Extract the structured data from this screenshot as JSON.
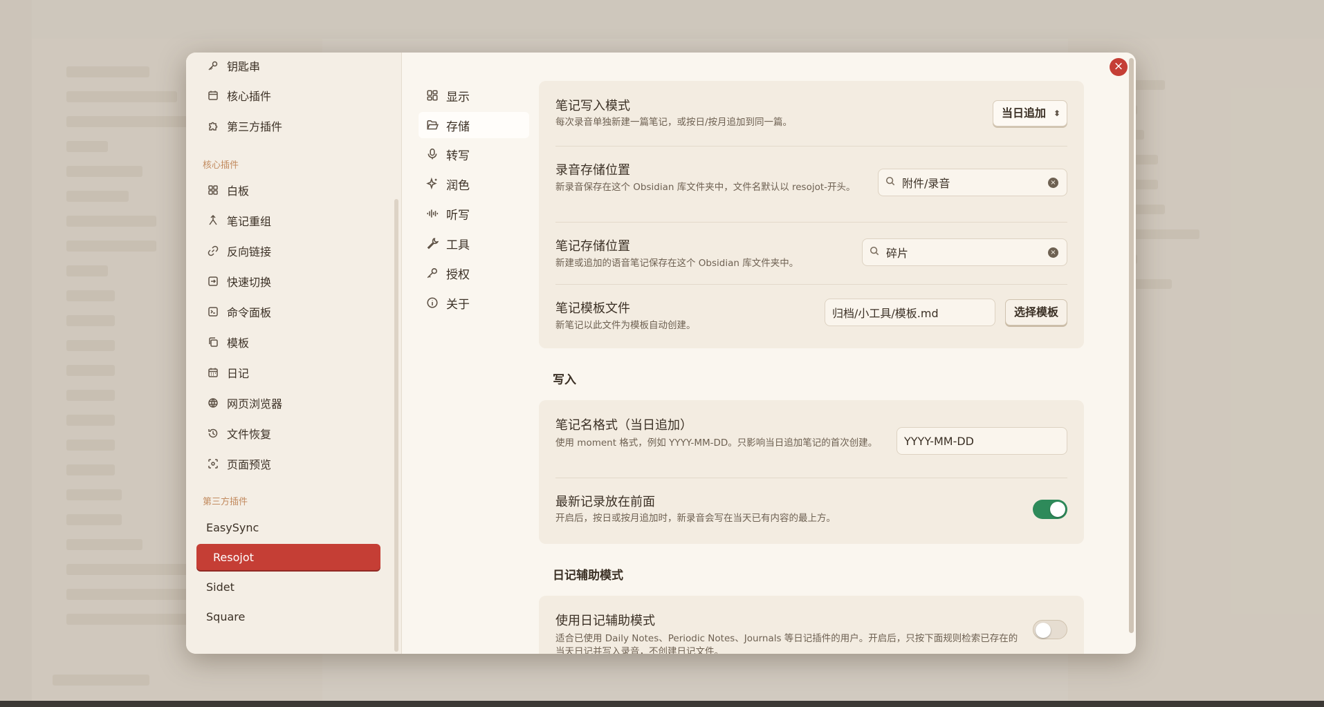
{
  "settings_sidebar": {
    "top_items": [
      {
        "label": "钥匙串",
        "icon": "key-icon"
      },
      {
        "label": "核心插件",
        "icon": "calendar-icon"
      },
      {
        "label": "第三方插件",
        "icon": "puzzle-icon"
      }
    ],
    "core_section_label": "核心插件",
    "core_items": [
      {
        "label": "白板",
        "icon": "canvas-icon"
      },
      {
        "label": "笔记重组",
        "icon": "merge-icon"
      },
      {
        "label": "反向链接",
        "icon": "link-icon"
      },
      {
        "label": "快速切换",
        "icon": "switch-icon"
      },
      {
        "label": "命令面板",
        "icon": "terminal-icon"
      },
      {
        "label": "模板",
        "icon": "copy-icon"
      },
      {
        "label": "日记",
        "icon": "calendar-icon"
      },
      {
        "label": "网页浏览器",
        "icon": "globe-icon"
      },
      {
        "label": "文件恢复",
        "icon": "history-icon"
      },
      {
        "label": "页面预览",
        "icon": "scan-eye-icon"
      }
    ],
    "third_party_section_label": "第三方插件",
    "third_party_items": [
      {
        "label": "EasySync"
      },
      {
        "label": "Resojot"
      },
      {
        "label": "Sidet"
      },
      {
        "label": "Square"
      }
    ],
    "active_item": "Resojot"
  },
  "tabs": [
    {
      "label": "显示",
      "icon": "layout-icon"
    },
    {
      "label": "存储",
      "icon": "folder-open-icon"
    },
    {
      "label": "转写",
      "icon": "microphone-icon"
    },
    {
      "label": "润色",
      "icon": "sparkles-icon"
    },
    {
      "label": "听写",
      "icon": "audio-lines-icon"
    },
    {
      "label": "工具",
      "icon": "wrench-icon"
    },
    {
      "label": "授权",
      "icon": "key-round-icon"
    },
    {
      "label": "关于",
      "icon": "info-icon"
    }
  ],
  "active_tab": "存储",
  "storage": {
    "write_mode": {
      "title": "笔记写入模式",
      "desc": "每次录音单独新建一篇笔记，或按日/按月追加到同一篇。",
      "value": "当日追加"
    },
    "audio_location": {
      "title": "录音存储位置",
      "desc": "新录音保存在这个 Obsidian 库文件夹中，文件名默认以 resojot-开头。",
      "value": "附件/录音"
    },
    "note_location": {
      "title": "笔记存储位置",
      "desc": "新建或追加的语音笔记保存在这个 Obsidian 库文件夹中。",
      "value": "碎片"
    },
    "template_file": {
      "title": "笔记模板文件",
      "desc": "新笔记以此文件为模板自动创建。",
      "value": "归档/小工具/模板.md",
      "button": "选择模板"
    }
  },
  "write_section": {
    "heading": "写入",
    "name_format": {
      "title": "笔记名格式（当日追加）",
      "desc": "使用 moment 格式，例如 YYYY-MM-DD。只影响当日追加笔记的首次创建。",
      "value": "YYYY-MM-DD"
    },
    "newest_first": {
      "title": "最新记录放在前面",
      "desc": "开启后，按日或按月追加时，新录音会写在当天已有内容的最上方。",
      "enabled": true
    }
  },
  "daily_section": {
    "heading": "日记辅助模式",
    "use_daily": {
      "title": "使用日记辅助模式",
      "desc": "适合已使用 Daily Notes、Periodic Notes、Journals 等日记插件的用户。开启后，只按下面规则检索已存在的当天日记并写入录音，不创建日记文件。",
      "enabled": false
    }
  },
  "colors": {
    "accent": "#c53e35",
    "toggle_on": "#2e8a5a"
  }
}
